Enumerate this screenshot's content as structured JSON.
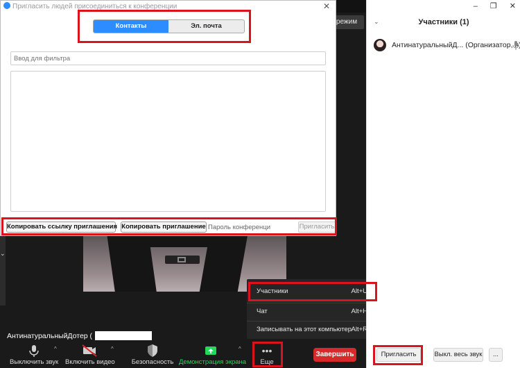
{
  "meeting": {
    "view_button": "режим",
    "name_tag": "АнтинатуральныйДотер ("
  },
  "toolbar": {
    "mute": "Выключить звук",
    "video": "Включить видео",
    "security": "Безопасность",
    "share": "Демонстрация экрана",
    "more": "Еще",
    "end": "Завершить",
    "accent": "#2d8cff",
    "share_color": "#23d959",
    "end_color": "#d62a2a"
  },
  "more_menu": {
    "items": [
      {
        "label": "Участники",
        "shortcut": "Alt+U"
      },
      {
        "label": "Чат",
        "shortcut": "Alt+H"
      },
      {
        "label": "Записывать на этот компьютер",
        "shortcut": "Alt+R"
      }
    ]
  },
  "right_panel": {
    "window_controls": [
      "–",
      "❐",
      "✕"
    ],
    "title": "Участники (1)",
    "participant_name": "АнтинатуральныйД... (Организатор, я)",
    "invite_button": "Пригласить",
    "mute_all_button": "Выкл. весь звук",
    "more_button": "..."
  },
  "invite_dialog": {
    "title": "Пригласить людей присоединиться к конференции",
    "tabs": [
      {
        "label": "Контакты"
      },
      {
        "label": "Эл. почта"
      }
    ],
    "filter_placeholder": "Ввод для фильтра",
    "copy_link_button": "Копировать ссылку приглашения",
    "copy_invite_button": "Копировать приглашение",
    "password_label": "Пароль конференции:",
    "invite_button": "Пригласить"
  }
}
